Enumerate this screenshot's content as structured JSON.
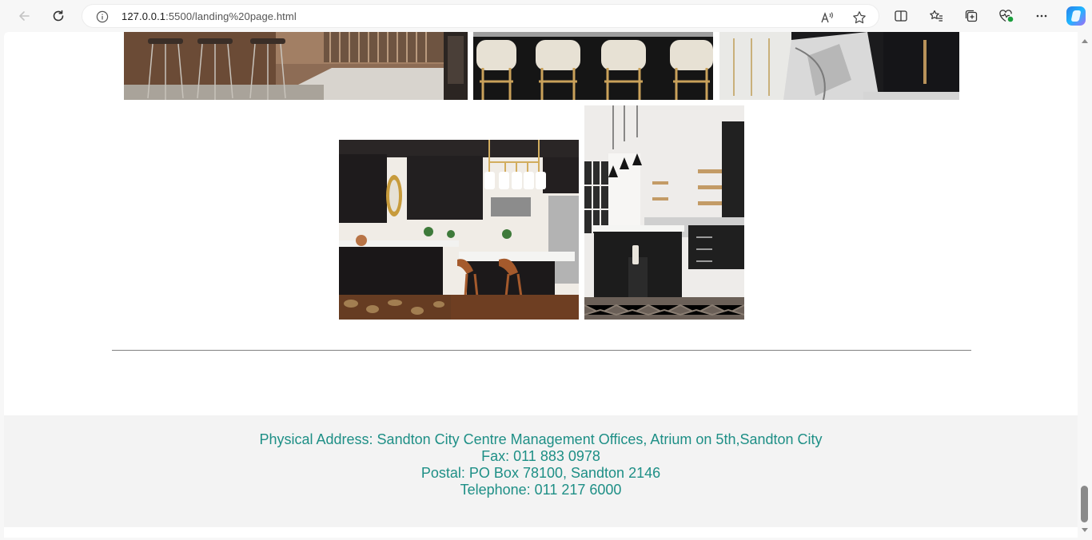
{
  "browser": {
    "url_host": "127.0.0.1",
    "url_rest": ":5500/landing%20page.html"
  },
  "gallery": {
    "top_row": [
      {
        "alt": "Kitchen with wooden bar stools",
        "name": "gallery-photo-wood-stools"
      },
      {
        "alt": "Kitchen island with cream upholstered stools",
        "name": "gallery-photo-cream-stools"
      },
      {
        "alt": "Kitchen with marble island",
        "name": "gallery-photo-marble-island"
      }
    ],
    "bottom_row": [
      {
        "alt": "Black kitchen with wooden stools and pendant lights",
        "name": "gallery-photo-black-kitchen"
      },
      {
        "alt": "Kitchen with pendant lamps and herringbone floor",
        "name": "gallery-photo-pendant-kitchen"
      }
    ]
  },
  "footer": {
    "address": "Physical Address: Sandton City Centre Management Offices, Atrium on 5th,Sandton City",
    "fax": "Fax: 011 883 0978",
    "postal": "Postal: PO Box 78100, Sandton 2146",
    "telephone": "Telephone: 011 217 6000"
  },
  "colors": {
    "footer_text": "#1e8f86",
    "footer_bg": "#f3f3f3",
    "divider": "#808080"
  }
}
